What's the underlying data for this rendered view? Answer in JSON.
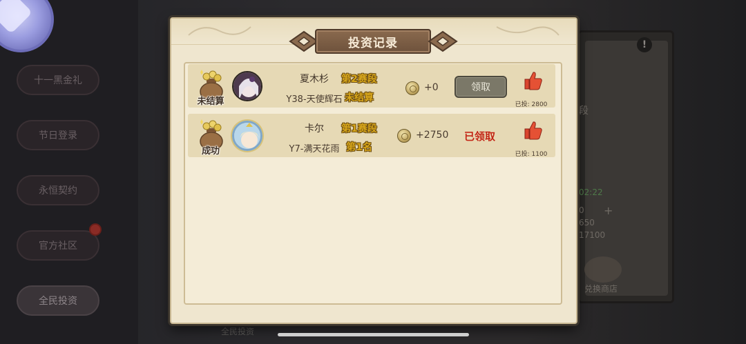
{
  "background": {
    "side_buttons": [
      "十一黑金礼",
      "节日登录",
      "永恒契约",
      "官方社区",
      "全民投资"
    ],
    "right_panel": {
      "label_partial": "段",
      "timer": "02:22",
      "line1": "0",
      "line2": "650",
      "line3": "17100",
      "shop_label": "兑换商店"
    },
    "bottom_label": "全民投资"
  },
  "dialog": {
    "title": "投资记录",
    "records": [
      {
        "status": "未结算",
        "player_name": "夏木杉",
        "server_tag": "Y38-天使辉石",
        "stage": "第2赛段",
        "result": "未结算",
        "reward": "+0",
        "action_label": "领取",
        "action_state": "disabled",
        "invested": "已投: 2800"
      },
      {
        "status": "成功",
        "player_name": "卡尔",
        "server_tag": "Y7-满天花雨",
        "stage": "第1赛段",
        "result": "第1名",
        "reward": "+2750",
        "action_label": "已领取",
        "action_state": "claimed",
        "invested": "已投: 1100"
      }
    ]
  },
  "colors": {
    "parchment": "#efe6cf",
    "row_bg": "#e6d9b5",
    "stage_gold": "#d7a61b",
    "claimed_red": "#c22616",
    "thumb_red": "#d9452e"
  }
}
